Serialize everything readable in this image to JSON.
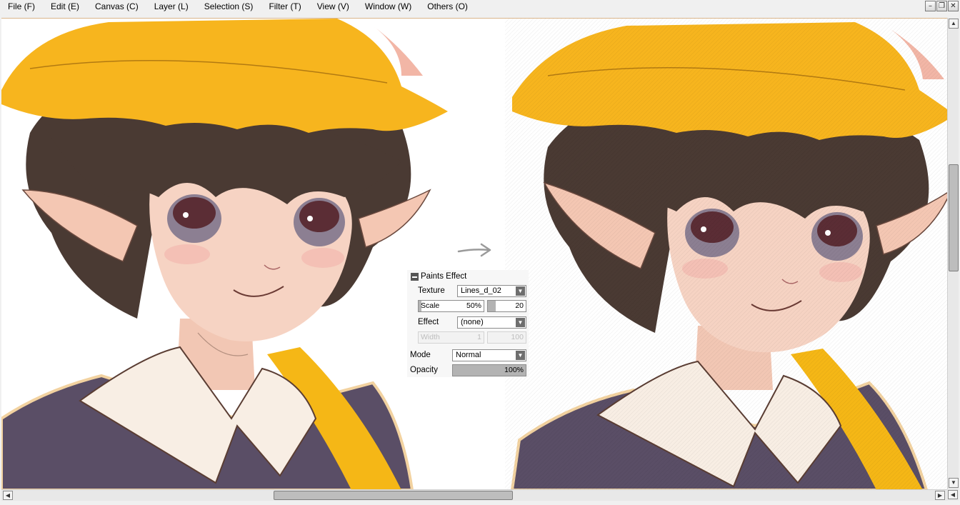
{
  "menu": [
    {
      "label": "File (F)"
    },
    {
      "label": "Edit (E)"
    },
    {
      "label": "Canvas (C)"
    },
    {
      "label": "Layer (L)"
    },
    {
      "label": "Selection (S)"
    },
    {
      "label": "Filter (T)"
    },
    {
      "label": "View (V)"
    },
    {
      "label": "Window (W)"
    },
    {
      "label": "Others (O)"
    }
  ],
  "window_controls": {
    "minimize": "–",
    "maximize": "❐",
    "close": "✕"
  },
  "canvas": {
    "left_art": "original-illustration",
    "right_art": "illustration-with-texture-effect",
    "arrow_icon": "right-arrow-icon"
  },
  "paints_effect": {
    "title": "Paints Effect",
    "texture_label": "Texture",
    "texture_value": "Lines_d_02",
    "scale_label": "Scale",
    "scale_value": "50%",
    "scale_fraction": 0.04,
    "strength_value": "20",
    "strength_fraction": 0.2,
    "effect_label": "Effect",
    "effect_value": "(none)",
    "width_label": "Width",
    "width_value": "1",
    "width_second_value": "100",
    "mode_label": "Mode",
    "mode_value": "Normal",
    "opacity_label": "Opacity",
    "opacity_value": "100%",
    "opacity_fraction": 1.0
  },
  "colors": {
    "hat_yellow": "#f7b51e",
    "hair_brown": "#4a3a33",
    "skin": "#f6d3c3",
    "uniform": "#5a4e66",
    "collar": "#f8eee4",
    "strap": "#f5b716"
  }
}
